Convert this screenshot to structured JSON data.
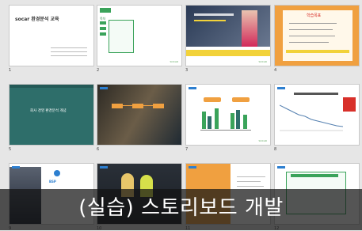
{
  "slides": [
    {
      "number": "1",
      "title": "socar 환경분석 교육",
      "footer": "SOCAR"
    },
    {
      "number": "2",
      "heading": "목차",
      "footer": "SOCAR"
    },
    {
      "number": "3",
      "footer": "SOCAR"
    },
    {
      "number": "4",
      "title": "학습목표",
      "footer": "SOCAR"
    },
    {
      "number": "5",
      "title": "회사 경영 환경분석 개념",
      "footer": "SOCAR"
    },
    {
      "number": "6",
      "footer": "SOCAR"
    },
    {
      "number": "7",
      "footer": "SOCAR"
    },
    {
      "number": "8",
      "footer": "SOCAR"
    },
    {
      "number": "9",
      "badge": "BSP",
      "footer": "SOCAR"
    },
    {
      "number": "10",
      "footer": "SOCAR"
    },
    {
      "number": "11",
      "footer": "SOCAR"
    },
    {
      "number": "12",
      "footer": "SOCAR"
    }
  ],
  "caption": "(실습) 스토리보드 개발",
  "colors": {
    "teal": "#2e6e6a",
    "green": "#3aa35a",
    "orange": "#f0a040",
    "yellow": "#f2d23a",
    "red": "#d8302a",
    "blue": "#2d7fd0"
  }
}
